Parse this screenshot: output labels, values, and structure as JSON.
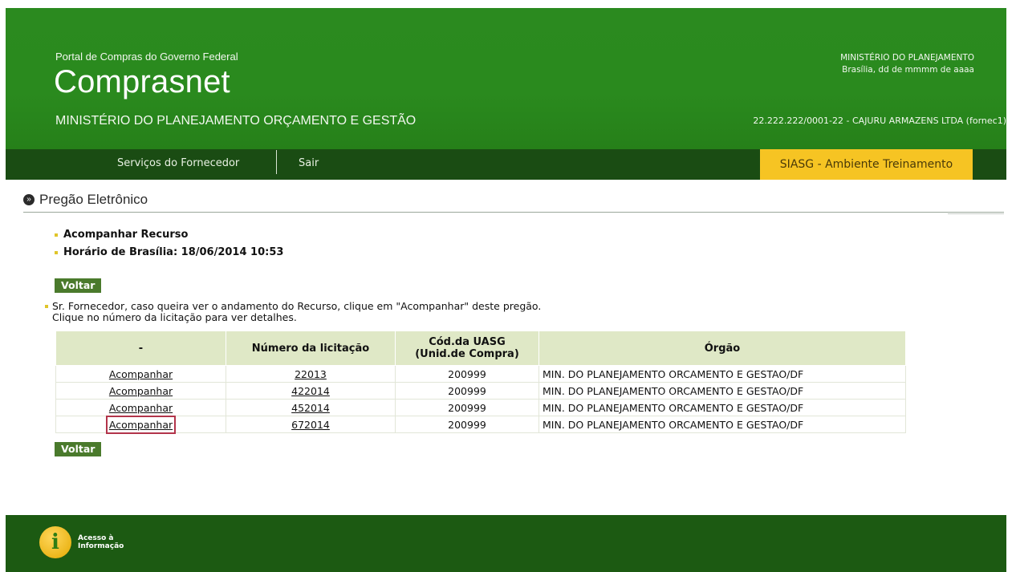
{
  "header": {
    "subtitle": "Portal de Compras do Governo Federal",
    "title": "Comprasnet",
    "ministry": "MINISTÉRIO DO PLANEJAMENTO ORÇAMENTO E GESTÃO",
    "top_right_line1": "MINISTÉRIO DO PLANEJAMENTO",
    "top_right_line2": "Brasília, dd de mmmm de aaaa",
    "user": "22.222.222/0001-22 - CAJURU ARMAZENS LTDA (fornec1)"
  },
  "nav": {
    "items": [
      "Serviços do Fornecedor",
      "Sair"
    ],
    "environment": "SIASG - Ambiente Treinamento"
  },
  "section": {
    "title": "Pregão Eletrônico"
  },
  "bullets": {
    "action": "Acompanhar Recurso",
    "time": "Horário de Brasília: 18/06/2014 10:53"
  },
  "buttons": {
    "voltar": "Voltar"
  },
  "note": {
    "line1": "Sr. Fornecedor, caso queira ver o andamento do Recurso, clique em \"Acompanhar\" deste pregão.",
    "line2": "Clique no número da licitação para ver detalhes."
  },
  "table": {
    "headers": [
      "-",
      "Número da licitação",
      "Cód.da UASG",
      "(Unid.de Compra)",
      "Órgão"
    ],
    "rows": [
      {
        "action": "Acompanhar",
        "numero": "22013",
        "uasg": "200999",
        "orgao": "MIN. DO PLANEJAMENTO ORCAMENTO E GESTAO/DF"
      },
      {
        "action": "Acompanhar",
        "numero": "422014",
        "uasg": "200999",
        "orgao": "MIN. DO PLANEJAMENTO ORCAMENTO E GESTAO/DF"
      },
      {
        "action": "Acompanhar",
        "numero": "452014",
        "uasg": "200999",
        "orgao": "MIN. DO PLANEJAMENTO ORCAMENTO E GESTAO/DF"
      },
      {
        "action": "Acompanhar",
        "numero": "672014",
        "uasg": "200999",
        "orgao": "MIN. DO PLANEJAMENTO ORCAMENTO E GESTAO/DF"
      }
    ]
  },
  "footer": {
    "acesso_line1": "Acesso à",
    "acesso_line2": "Informação",
    "acesso_icon": "i"
  },
  "colors": {
    "header_green": "#2b8a1f",
    "nav_dark": "#1a4c13",
    "env_yellow": "#f6c423",
    "highlight": "#b2344a"
  }
}
